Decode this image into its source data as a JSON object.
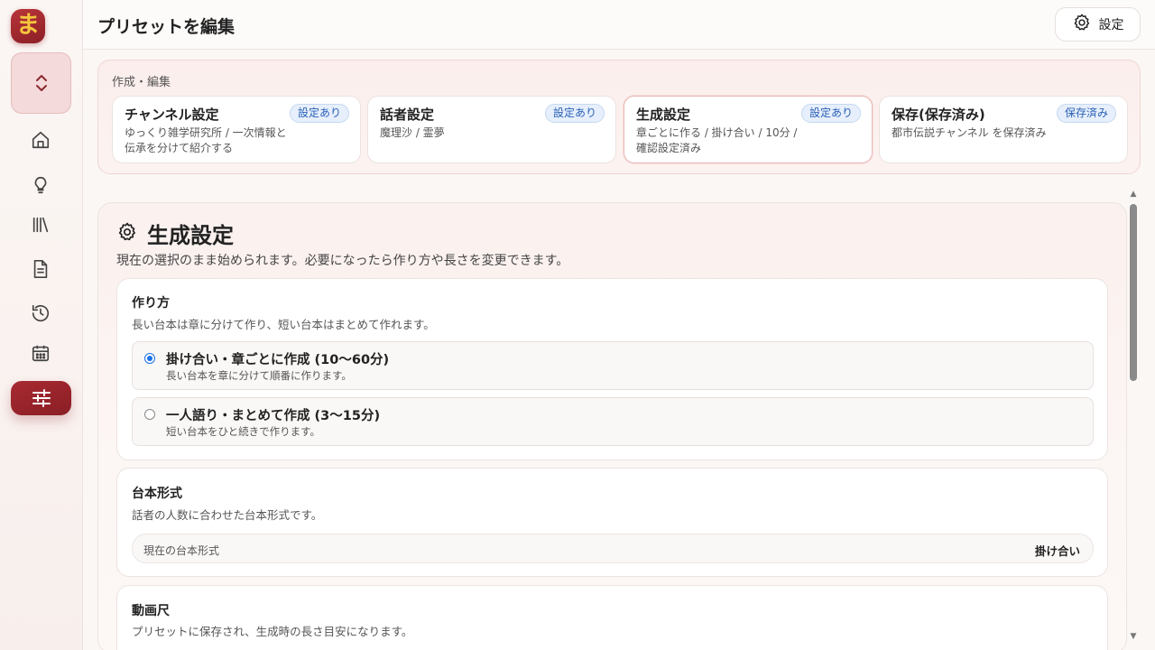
{
  "sidebar": {
    "logo_text": "ま",
    "nav": [
      {
        "icon": "chevron-up-down-icon"
      },
      {
        "icon": "home-icon"
      },
      {
        "icon": "lightbulb-icon"
      },
      {
        "icon": "library-icon"
      },
      {
        "icon": "document-icon"
      },
      {
        "icon": "history-icon"
      },
      {
        "icon": "calendar-icon"
      },
      {
        "icon": "sliders-icon",
        "active": true
      }
    ]
  },
  "header": {
    "title": "プリセットを編集",
    "settings_label": "設定"
  },
  "stepper": {
    "label": "作成・編集",
    "steps": [
      {
        "title": "チャンネル設定",
        "badge": "設定あり",
        "desc": "ゆっくり雑学研究所 / 一次情報と伝承を分けて紹介する"
      },
      {
        "title": "話者設定",
        "badge": "設定あり",
        "desc": "魔理沙 / 霊夢"
      },
      {
        "title": "生成設定",
        "badge": "設定あり",
        "desc": "章ごとに作る / 掛け合い / 10分 / 確認設定済み",
        "current": true
      },
      {
        "title": "保存(保存済み)",
        "badge": "保存済み",
        "desc": "都市伝説チャンネル を保存済み"
      }
    ]
  },
  "main": {
    "title": "生成設定",
    "desc": "現在の選択のまま始められます。必要になったら作り方や長さを変更できます。",
    "method": {
      "title": "作り方",
      "desc": "長い台本は章に分けて作り、短い台本はまとめて作れます。",
      "options": [
        {
          "title": "掛け合い・章ごとに作成 (10〜60分)",
          "desc": "長い台本を章に分けて順番に作ります。",
          "selected": true
        },
        {
          "title": "一人語り・まとめて作成 (3〜15分)",
          "desc": "短い台本をひと続きで作ります。",
          "selected": false
        }
      ]
    },
    "format": {
      "title": "台本形式",
      "desc": "話者の人数に合わせた台本形式です。",
      "current_label": "現在の台本形式",
      "current_value": "掛け合い"
    },
    "length": {
      "title": "動画尺",
      "desc": "プリセットに保存され、生成時の長さ目安になります。"
    }
  },
  "colors": {
    "accent": "#9a242b",
    "badge_blue": "#2b61b8",
    "radio_blue": "#1a73e8"
  }
}
